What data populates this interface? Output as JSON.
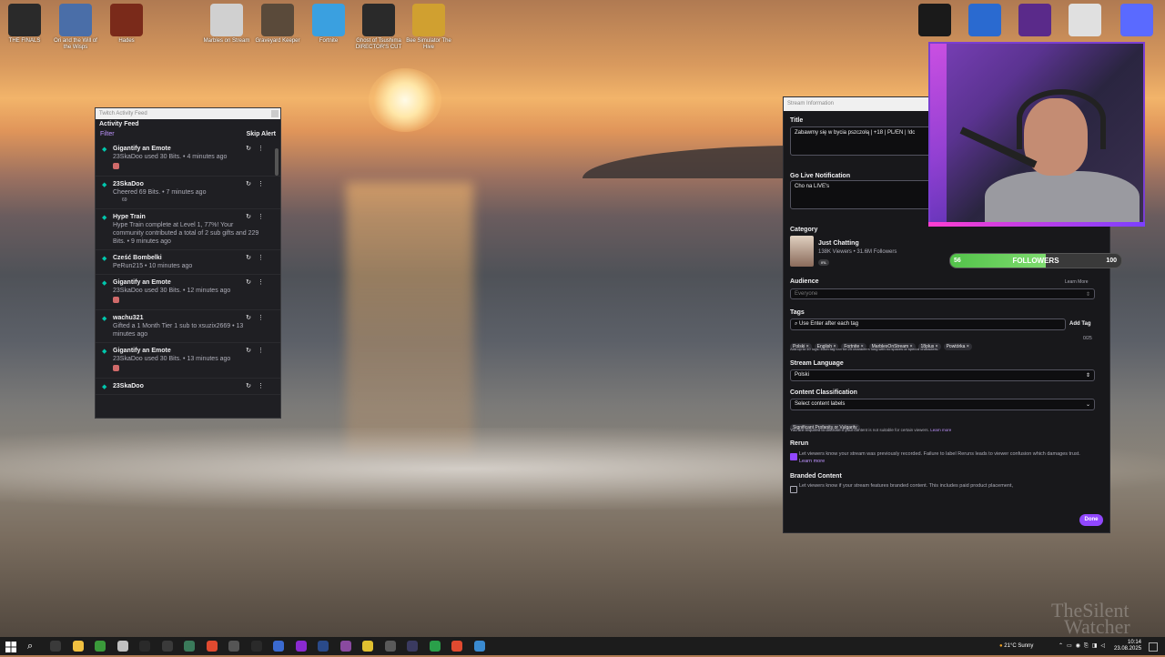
{
  "desktop": {
    "icons": [
      {
        "label": "THE FINALS",
        "color": "#2a2a2a"
      },
      {
        "label": "Ori and the Will of the Wisps",
        "color": "#4a6ea8"
      },
      {
        "label": "Hades",
        "color": "#7a2a1a"
      },
      {
        "label": "Marbles on Stream",
        "color": "#d0d0d0"
      },
      {
        "label": "Graveyard Keeper",
        "color": "#5a4a3a"
      },
      {
        "label": "Fortnite",
        "color": "#3aa0e0"
      },
      {
        "label": "Ghost of Tsushima DIRECTOR'S CUT",
        "color": "#2a2a2a"
      },
      {
        "label": "Bee Simulator The Hive",
        "color": "#d0a030"
      }
    ],
    "right_icons": [
      {
        "label": "",
        "color": "#1a1a1a"
      },
      {
        "label": "",
        "color": "#2a6ad0"
      },
      {
        "label": "",
        "color": "#5a2a8a"
      },
      {
        "label": "",
        "color": "#e0e0e0"
      },
      {
        "label": "",
        "color": "#5a6aff"
      }
    ]
  },
  "activity_feed": {
    "window_title": "Twitch Activity Feed",
    "header": "Activity Feed",
    "filter_label": "Filter",
    "skip_label": "Skip Alert",
    "items": [
      {
        "title": "Gigantify an Emote",
        "line": "23SkaDoo used 30 Bits.",
        "time": "4 minutes ago",
        "emote": true
      },
      {
        "title": "23SkaDoo",
        "line": "Cheered 69 Bits.",
        "time": "7 minutes ago",
        "emote": false,
        "extra": "69"
      },
      {
        "title": "Hype Train",
        "line": "Hype Train complete at Level 1, 77%! Your community contributed a total of 2 sub gifts and 229 Bits.",
        "time": "9 minutes ago",
        "emote": false
      },
      {
        "title": "Cześć Bombelki",
        "line": "PeRun215",
        "time": "10 minutes ago",
        "emote": false
      },
      {
        "title": "Gigantify an Emote",
        "line": "23SkaDoo used 30 Bits.",
        "time": "12 minutes ago",
        "emote": true
      },
      {
        "title": "wachu321",
        "line": "Gifted a 1 Month Tier 1 sub to xsuzix2669",
        "time": "13 minutes ago",
        "emote": false
      },
      {
        "title": "Gigantify an Emote",
        "line": "23SkaDoo used 30 Bits.",
        "time": "13 minutes ago",
        "emote": true
      },
      {
        "title": "23SkaDoo",
        "line": "",
        "time": "",
        "emote": false
      }
    ]
  },
  "stream_info": {
    "window_title": "Stream Information",
    "title_label": "Title",
    "title_value": "Zabawmy się w bycia pszczołą | +18 | PL/EN | !dc",
    "notif_label": "Go Live Notification",
    "notif_value": "Cho na LIVE's",
    "category_label": "Category",
    "category_name": "Just Chatting",
    "category_viewers": "138K Viewers",
    "category_followers": "31.6M Followers",
    "category_badge": "IRL",
    "audience_label": "Audience",
    "audience_learn": "Learn More",
    "audience_value": "Everyone",
    "tags_label": "Tags",
    "tags_placeholder": "Use Enter after each tag",
    "add_tag": "Add Tag",
    "tags": [
      "Polski",
      "English",
      "Fortnite",
      "MarblesOnStream",
      "18plus",
      "Powtórka"
    ],
    "tags_help": "Add up to 10 tags. Each tag can be 25 characters long with no spaces or special characters.",
    "tags_count": "0/25",
    "language_label": "Stream Language",
    "language_value": "Polski",
    "classification_label": "Content Classification",
    "classification_placeholder": "Select content labels",
    "classification_tag": "Significant Profanity or Vulgarity",
    "classification_help": "You are required to disclose if your content is not suitable for certain viewers.",
    "classification_learn": "Learn more",
    "rerun_label": "Rerun",
    "rerun_text": "Let viewers know your stream was previously recorded. Failure to label Reruns leads to viewer confusion which damages trust.",
    "rerun_learn": "Learn more",
    "branded_label": "Branded Content",
    "branded_text": "Let viewers know if your stream features branded content. This includes paid product placement,",
    "done_label": "Done"
  },
  "followers": {
    "current": "56",
    "goal": "100",
    "label": "FOLLOWERS",
    "progress": 0.56
  },
  "watermark": {
    "line1": "TheSilent",
    "line2": "Watcher"
  },
  "taskbar": {
    "weather": "21°C  Sunny",
    "time": "10:14",
    "date": "23.08.2025"
  }
}
